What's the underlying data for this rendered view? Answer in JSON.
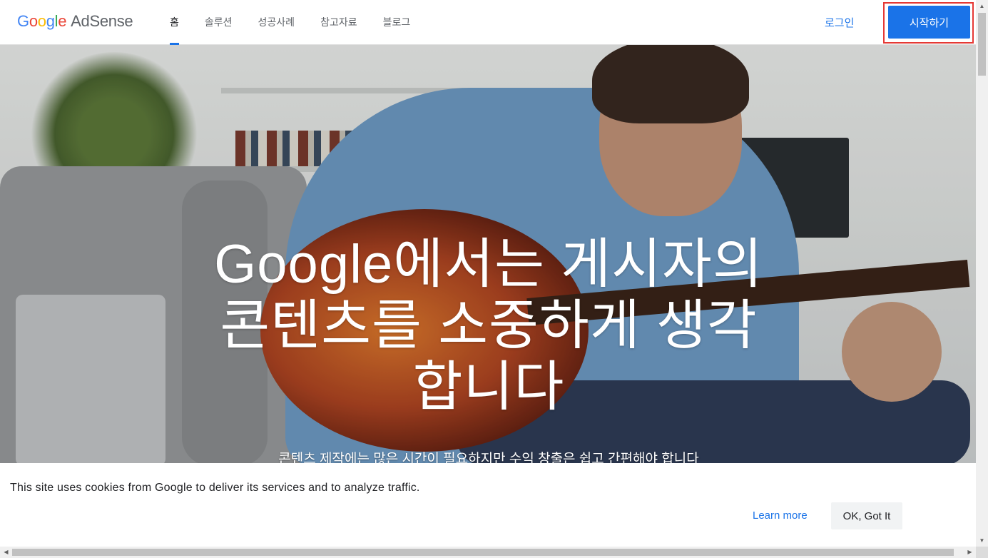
{
  "header": {
    "logo_google": [
      "G",
      "o",
      "o",
      "g",
      "l",
      "e"
    ],
    "logo_product": "AdSense",
    "nav": [
      {
        "label": "홈",
        "active": true
      },
      {
        "label": "솔루션",
        "active": false
      },
      {
        "label": "성공사례",
        "active": false
      },
      {
        "label": "참고자료",
        "active": false
      },
      {
        "label": "블로그",
        "active": false
      }
    ],
    "login_label": "로그인",
    "start_label": "시작하기"
  },
  "hero": {
    "title": "Google에서는 게시자의 콘텐츠를 소중하게 생각합니다",
    "subtitle": "콘텐츠 제작에는 많은 시간이 필요하지만 수익 창출은 쉽고 간편해야 합니다"
  },
  "cookie_bar": {
    "message": "This site uses cookies from Google to deliver its services and to analyze traffic.",
    "learn_more_label": "Learn more",
    "ok_label": "OK, Got It"
  },
  "colors": {
    "accent": "#1a73e8",
    "highlight_border": "#e53935"
  },
  "icons": {
    "scroll_up": "▲",
    "scroll_down": "▼",
    "scroll_left": "◀",
    "scroll_right": "▶"
  }
}
